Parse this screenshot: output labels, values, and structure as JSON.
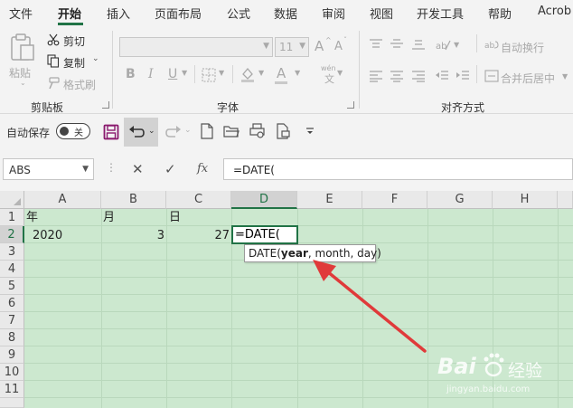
{
  "menu": {
    "tabs": [
      "文件",
      "开始",
      "插入",
      "页面布局",
      "公式",
      "数据",
      "审阅",
      "视图",
      "开发工具",
      "帮助",
      "Acrob"
    ],
    "active_tab": "开始"
  },
  "ribbon": {
    "clipboard": {
      "paste": "粘贴",
      "cut": "剪切",
      "copy": "复制",
      "format_painter": "格式刷",
      "label": "剪贴板"
    },
    "font": {
      "font_size": "11",
      "grow": "A",
      "shrink": "A",
      "bold": "B",
      "italic": "I",
      "underline": "U",
      "label": "字体",
      "phonetic": "wén"
    },
    "alignment": {
      "wrap_text": "自动换行",
      "merge_center": "合并后居中",
      "label": "对齐方式"
    }
  },
  "quick_access": {
    "autosave_label": "自动保存",
    "autosave_state": "关"
  },
  "formula_bar": {
    "name_box": "ABS",
    "cancel": "✕",
    "enter": "✓",
    "fx": "fx",
    "formula": "=DATE("
  },
  "sheet": {
    "columns": [
      "A",
      "B",
      "C",
      "D",
      "E",
      "F",
      "G",
      "H"
    ],
    "rows": [
      "1",
      "2",
      "3",
      "4",
      "5",
      "6",
      "7",
      "8",
      "9",
      "10",
      "11"
    ],
    "selected_column": "D",
    "selected_row": "2",
    "cells": {
      "A1": "年",
      "B1": "月",
      "C1": "日",
      "A2": "2020",
      "B2": "3",
      "C2": "27",
      "D2": "=DATE("
    },
    "tooltip": {
      "prefix": "DATE(",
      "bold_arg": "year",
      "rest": ", month, day)"
    }
  },
  "watermark": {
    "brand": "Bai",
    "brand2": "经验",
    "url": "jingyan.baidu.com"
  },
  "colors": {
    "accent": "#217346",
    "sheet_background": "#cce8cf",
    "arrow": "#e03a3a"
  }
}
